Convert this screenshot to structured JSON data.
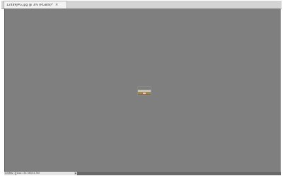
{
  "document": {
    "tab_label": "12489JPG.jpg @ 3% (RGB/8)",
    "tab_close_glyph": "×",
    "tab_modified_marker": "*"
  },
  "canvas": {
    "background_color": "#7f7f7f",
    "image_thumbnail": "landscape-photo-with-vehicle"
  },
  "status_bar": {
    "zoom": "3.05%",
    "doc_info": "Doc: 34.5M/34.5M",
    "arrow_glyph": "▸"
  },
  "colors": {
    "workspace_gray": "#7f7f7f",
    "tab_bar": "#d4d4d4"
  }
}
